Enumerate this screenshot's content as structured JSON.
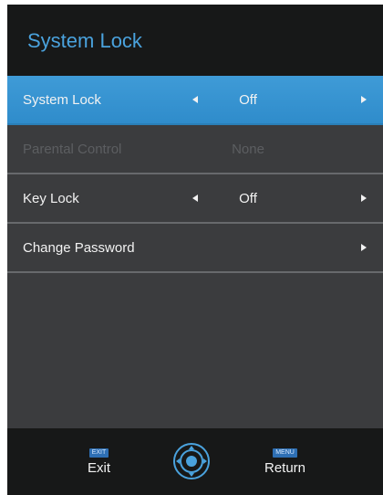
{
  "header": {
    "title": "System Lock"
  },
  "menu": {
    "items": [
      {
        "label": "System Lock",
        "value": "Off",
        "selected": true,
        "enabled": true
      },
      {
        "label": "Parental Control",
        "value": "None",
        "selected": false,
        "enabled": false
      },
      {
        "label": "Key Lock",
        "value": "Off",
        "selected": false,
        "enabled": true
      },
      {
        "label": "Change Password",
        "value": "",
        "selected": false,
        "enabled": true
      }
    ]
  },
  "footer": {
    "exit_tag": "EXIT",
    "exit_label": "Exit",
    "center_icon": "navigation-dpad-icon",
    "menu_tag": "MENU",
    "return_label": "Return"
  },
  "colors": {
    "accent": "#3d9bd8",
    "panel": "#3b3c3e",
    "header_footer": "#171818",
    "disabled_text": "#5c5e61"
  }
}
